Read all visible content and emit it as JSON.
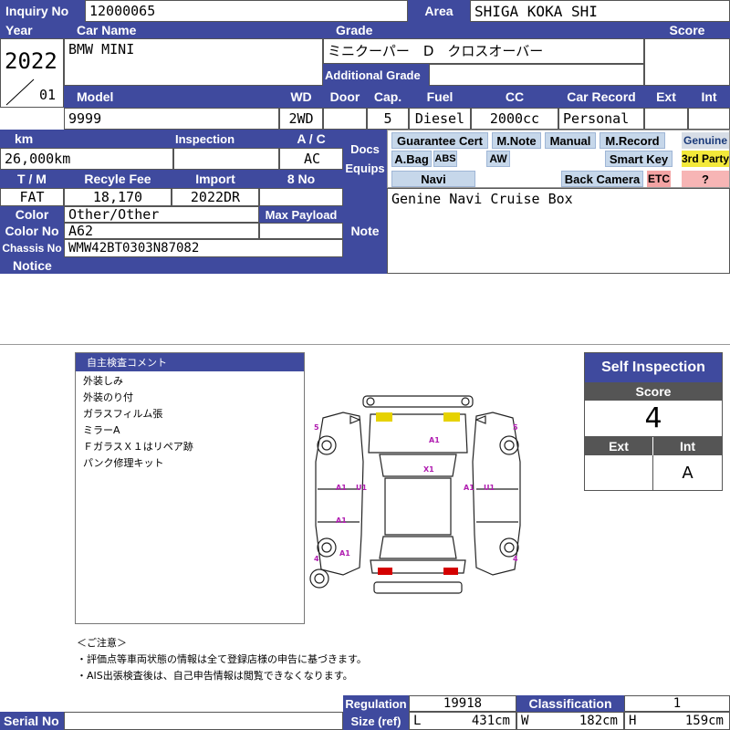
{
  "header": {
    "inquiry_no_label": "Inquiry No",
    "inquiry_no": "12000065",
    "area_label": "Area",
    "area": "SHIGA KOKA SHI"
  },
  "vehicle": {
    "year_label": "Year",
    "year": "2022",
    "month": "01",
    "car_name_label": "Car Name",
    "car_name": "BMW MINI",
    "grade_label": "Grade",
    "grade": "ミニクーパー　D　クロスオーバー",
    "additional_grade_label": "Additional Grade",
    "additional_grade": "",
    "score_label": "Score",
    "score": "",
    "model_label": "Model",
    "model": "9999",
    "wd_label": "WD",
    "wd": "2WD",
    "door_label": "Door",
    "door": "",
    "cap_label": "Cap.",
    "cap": "5",
    "fuel_label": "Fuel",
    "fuel": "Diesel",
    "cc_label": "CC",
    "cc": "2000cc",
    "car_record_label": "Car Record",
    "car_record": "Personal",
    "ext_label": "Ext",
    "ext": "",
    "int_label": "Int",
    "int": ""
  },
  "details": {
    "km_label": "km",
    "km": "26,000km",
    "inspection_label": "Inspection",
    "inspection": "",
    "ac_label": "A / C",
    "ac": "AC",
    "tm_label": "T / M",
    "tm": "FAT",
    "recycle_label": "Recyle Fee",
    "recycle": "18,170",
    "import_label": "Import",
    "import": "2022DR",
    "eight_no_label": "8 No",
    "eight_no": "",
    "color_label": "Color",
    "color": "Other/Other",
    "max_payload_label": "Max Payload",
    "max_payload": "",
    "color_no_label": "Color No",
    "color_no": "A62",
    "chassis_label": "Chassis No",
    "chassis": "WMW42BT0303N87082",
    "notice_label": "Notice",
    "notice": ""
  },
  "docs": {
    "label_line1": "Docs",
    "label_line2": "Equips",
    "badges": {
      "guarantee": "Guarantee Cert",
      "mnote": "M.Note",
      "manual": "Manual",
      "mrecord": "M.Record",
      "genuine": "Genuine",
      "abag": "A.Bag",
      "abs": "ABS",
      "aw": "AW",
      "smartkey": "Smart Key",
      "thirdparty": "3rd Party",
      "navi": "Navi",
      "backcamera": "Back Camera",
      "etc": "ETC",
      "question": "?"
    }
  },
  "note": {
    "label": "Note",
    "text": "Genine Navi Cruise Box"
  },
  "comment": {
    "title": "自主検査コメント",
    "lines": [
      "外装しみ",
      "外装のり付",
      "ガラスフィルム張",
      "ミラーA",
      "ＦガラスＸ１はリペア跡",
      "パンク修理キット"
    ]
  },
  "diagram": {
    "marks": [
      "A1",
      "X1",
      "A1",
      "U1",
      "A1",
      "U1",
      "A1",
      "A1",
      "5",
      "5",
      "4",
      "4"
    ]
  },
  "self_inspection": {
    "title": "Self Inspection",
    "score_label": "Score",
    "score": "4",
    "ext_label": "Ext",
    "ext": "",
    "int_label": "Int",
    "int": "A"
  },
  "caution": {
    "title": "＜ご注意＞",
    "line1": "・評価点等車両状態の情報は全て登録店様の申告に基づきます。",
    "line2": "・AIS出張検査後は、自己申告情報は閲覧できなくなります。"
  },
  "footer": {
    "serial_label": "Serial No",
    "serial": "",
    "regulation_label": "Regulation",
    "regulation": "19918",
    "classification_label": "Classification",
    "classification": "1",
    "size_label": "Size (ref)",
    "l_label": "L",
    "l": "431cm",
    "w_label": "W",
    "w": "182cm",
    "h_label": "H",
    "h": "159cm"
  },
  "colors": {
    "header_blue": "#3f4a9e",
    "badge_blue": "#c6d7ea",
    "badge_yellow": "#f3e93a",
    "badge_red": "#f3a3a3",
    "mark_magenta": "#b01cb0"
  }
}
